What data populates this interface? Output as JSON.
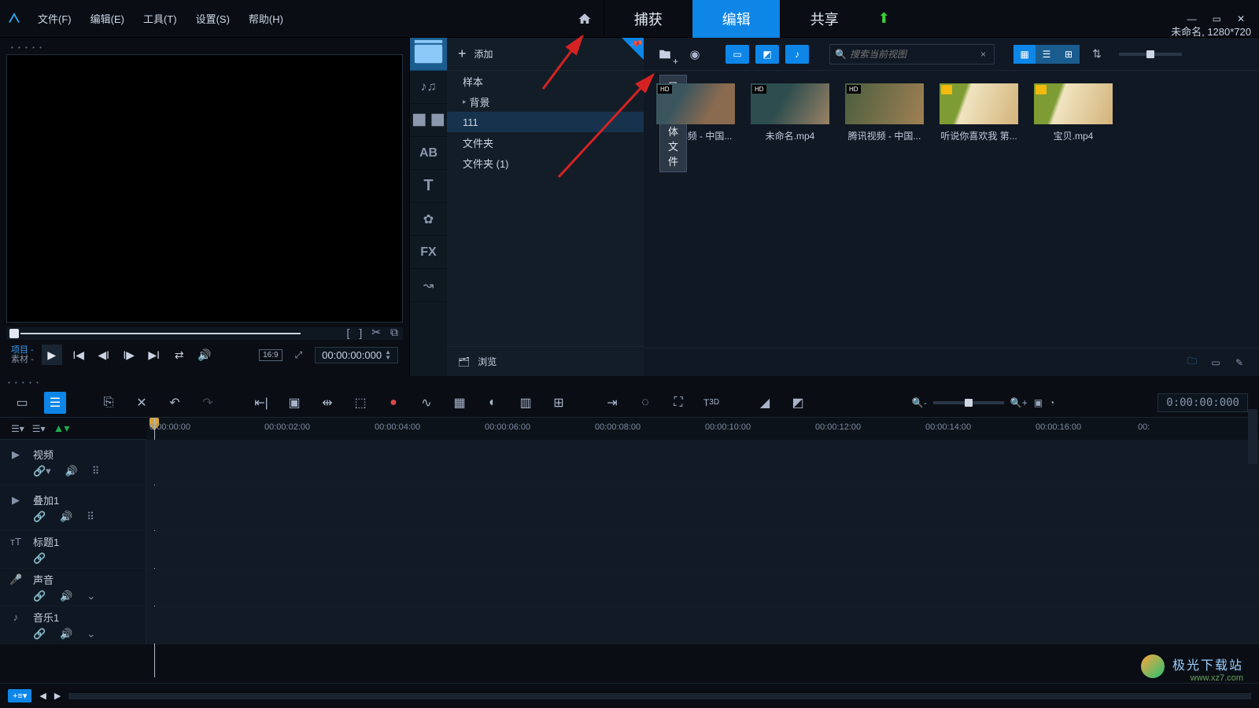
{
  "title_bar": {
    "menus": {
      "file": "文件(F)",
      "edit": "编辑(E)",
      "tools": "工具(T)",
      "settings": "设置(S)",
      "help": "帮助(H)"
    },
    "project_info": "未命名, 1280*720"
  },
  "mode_tabs": {
    "capture": "捕获",
    "edit": "编辑",
    "share": "共享"
  },
  "preview": {
    "labels": {
      "project": "项目 -",
      "material": "素材 -"
    },
    "aspect": "16:9",
    "timecode": "00:00:00:000"
  },
  "library": {
    "add_label": "添加",
    "tree": {
      "sample": "样本",
      "background": "背景",
      "folder111": "111",
      "folder": "文件夹",
      "folder1": "文件夹 (1)"
    },
    "browse_label": "浏览",
    "tooltip": "导入媒体文件",
    "search": {
      "placeholder": "搜索当前视图"
    },
    "thumbs": [
      {
        "name": "腾讯视频 - 中国..."
      },
      {
        "name": "未命名.mp4"
      },
      {
        "name": "腾讯视频 - 中国..."
      },
      {
        "name": "听说你喜欢我 第..."
      },
      {
        "name": "宝贝.mp4"
      }
    ]
  },
  "timeline": {
    "tc": "0:00:00:000",
    "ruler": [
      {
        "pos": 4,
        "label": "0:00:00:00"
      },
      {
        "pos": 150,
        "label": "00:00:02:00"
      },
      {
        "pos": 290,
        "label": "00:00:04:00"
      },
      {
        "pos": 430,
        "label": "00:00:06:00"
      },
      {
        "pos": 570,
        "label": "00:00:08:00"
      },
      {
        "pos": 710,
        "label": "00:00:10:00"
      },
      {
        "pos": 850,
        "label": "00:00:12:00"
      },
      {
        "pos": 990,
        "label": "00:00:14:00"
      },
      {
        "pos": 1130,
        "label": "00:00:16:00"
      },
      {
        "pos": 1260,
        "label": "00:"
      }
    ],
    "tracks": {
      "video": "视频",
      "overlay": "叠加1",
      "title": "标题1",
      "voice": "声音",
      "music": "音乐1"
    }
  },
  "watermark": {
    "main": "极光下载站",
    "sub": "www.xz7.com"
  }
}
